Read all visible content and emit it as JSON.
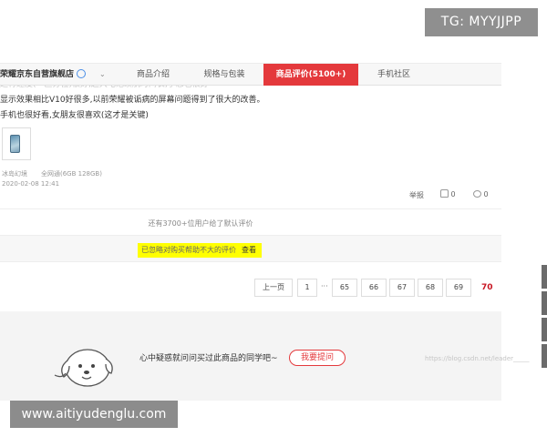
{
  "watermarks": {
    "tg": "TG: MYYJJPP",
    "url": "www.aitiyudenglu.com",
    "csdn": "https://blog.csdn.net/leader_____"
  },
  "tabbar": {
    "shop_name": "荣耀京东自营旗舰店",
    "shop_caret": "⌄",
    "tabs": [
      {
        "label": "商品介绍",
        "active": false
      },
      {
        "label": "规格与包装",
        "active": false
      },
      {
        "label": "商品评价(5100+)",
        "active": true
      },
      {
        "label": "手机社区",
        "active": false
      }
    ]
  },
  "review": {
    "line_top_partial": "运行速度(一区分位)很好,超大电池续航时间长,手感也很好",
    "line1": "显示效果相比V10好很多,以前荣耀被诟病的屏幕问题得到了很大的改善。",
    "line2": "手机也很好看,女朋友很喜欢(这才是关键)",
    "color": "冰岛幻境",
    "spec": "全网通(6GB 128GB)",
    "date": "2020-02-08 12:41",
    "report_label": "举报",
    "like_count": "0",
    "reply_count": "0"
  },
  "summary": {
    "default_note": "还有3700+位用户给了默认评价",
    "folded_text": "已忽略对购买帮助不大的评价",
    "folded_link": "查看"
  },
  "pagination": {
    "prev_label": "上一页",
    "pages": [
      "1",
      "65",
      "66",
      "67",
      "68",
      "69"
    ],
    "ellipsis": "···",
    "current": "70"
  },
  "qa": {
    "prompt": "心中疑惑就问问买过此商品的同学吧~",
    "ask_button": "我要提问"
  },
  "colors": {
    "accent": "#e4393c",
    "highlight": "#ffff00",
    "current_page": "#c81623"
  }
}
